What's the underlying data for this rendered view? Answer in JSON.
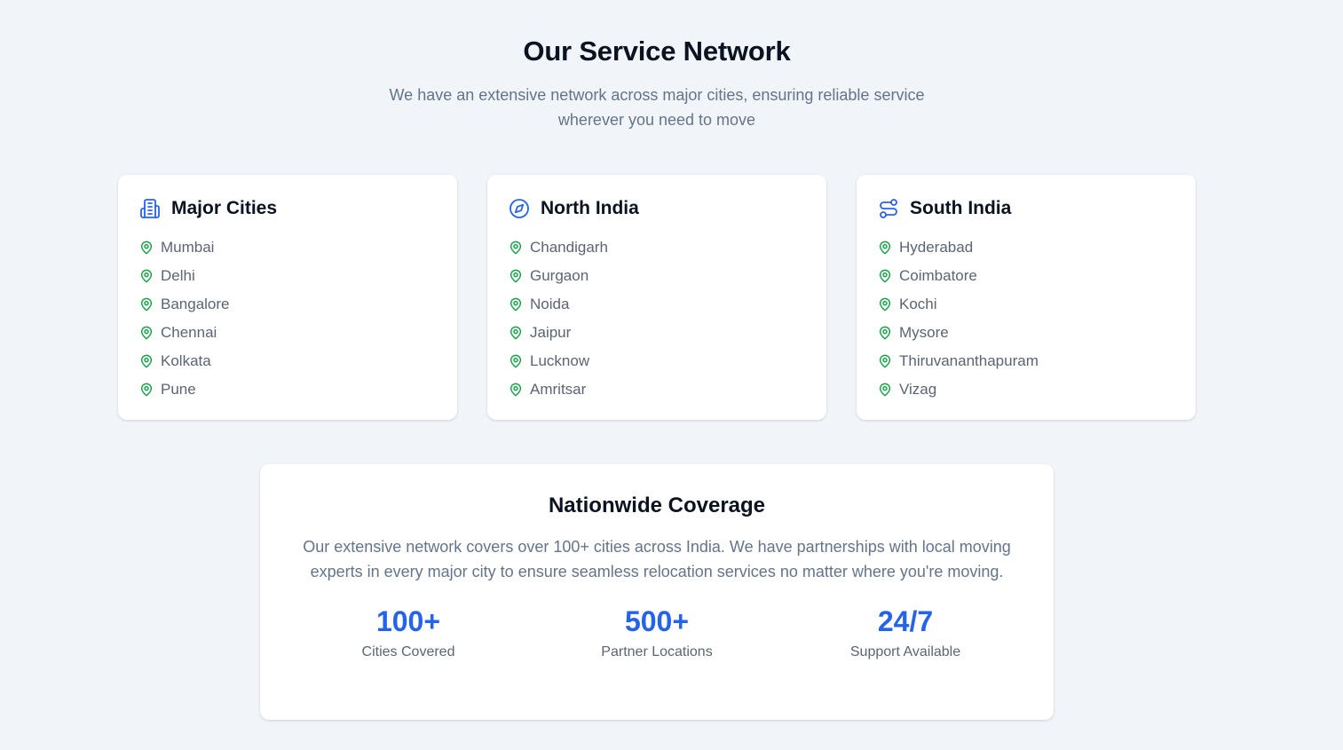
{
  "header": {
    "title": "Our Service Network",
    "subtitle": "We have an extensive network across major cities, ensuring reliable service wherever you need to move"
  },
  "colors": {
    "accent": "#2563eb",
    "pin": "#16a34a",
    "background": "#f1f4f8"
  },
  "cards": [
    {
      "title": "Major Cities",
      "icon": "building-icon",
      "cities": [
        "Mumbai",
        "Delhi",
        "Bangalore",
        "Chennai",
        "Kolkata",
        "Pune"
      ]
    },
    {
      "title": "North India",
      "icon": "compass-icon",
      "cities": [
        "Chandigarh",
        "Gurgaon",
        "Noida",
        "Jaipur",
        "Lucknow",
        "Amritsar"
      ]
    },
    {
      "title": "South India",
      "icon": "route-icon",
      "cities": [
        "Hyderabad",
        "Coimbatore",
        "Kochi",
        "Mysore",
        "Thiruvananthapuram",
        "Vizag"
      ]
    }
  ],
  "coverage": {
    "title": "Nationwide Coverage",
    "description": "Our extensive network covers over 100+ cities across India. We have partnerships with local moving experts in every major city to ensure seamless relocation services no matter where you're moving.",
    "stats": [
      {
        "value": "100+",
        "label": "Cities Covered"
      },
      {
        "value": "500+",
        "label": "Partner Locations"
      },
      {
        "value": "24/7",
        "label": "Support Available"
      }
    ]
  }
}
